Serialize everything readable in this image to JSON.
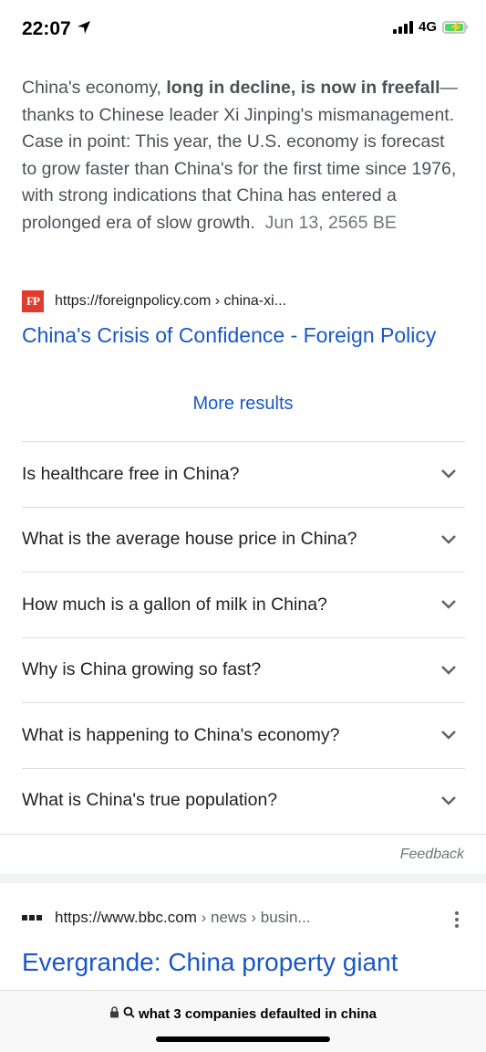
{
  "status": {
    "time": "22:07",
    "network": "4G"
  },
  "snippet": {
    "text1": "China's economy, ",
    "bold": "long in decline, is now in freefall",
    "text2": "—thanks to Chinese leader Xi Jinping's mismanagement. Case in point: This year, the U.S. economy is forecast to grow faster than China's for the first time since 1976, with strong indications that China has entered a prolonged era of slow growth.",
    "date": "Jun 13, 2565 BE"
  },
  "result1": {
    "logo": "FP",
    "url": "https://foreignpolicy.com › china-xi...",
    "title": "China's Crisis of Confidence - Foreign Policy"
  },
  "more_results": "More results",
  "faq": [
    "Is healthcare free in China?",
    "What is the average house price in China?",
    "How much is a gallon of milk in China?",
    "Why is China growing so fast?",
    "What is happening to China's economy?",
    "What is China's true population?"
  ],
  "feedback": "Feedback",
  "result2": {
    "url_main": "https://www.bbc.com",
    "url_path": " › news › busin...",
    "title": "Evergrande: China property giant"
  },
  "address_bar": {
    "query": "what 3 companies defaulted in china"
  },
  "colors": {
    "link": "#1a57c9",
    "fp_logo": "#e03b2c",
    "battery": "#4cd964"
  }
}
